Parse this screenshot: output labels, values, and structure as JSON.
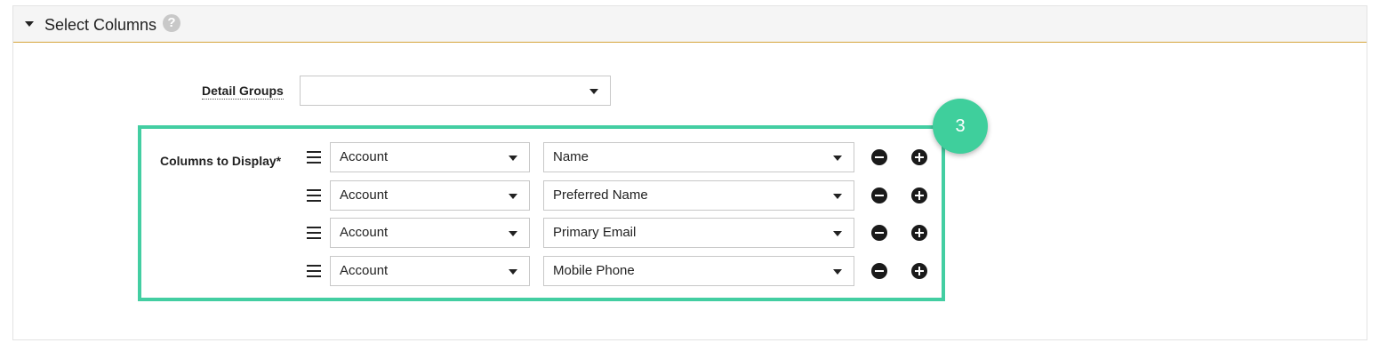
{
  "section": {
    "title": "Select Columns",
    "help_icon": "question-circle-icon"
  },
  "detail_groups": {
    "label": "Detail Groups",
    "value": ""
  },
  "columns": {
    "label": "Columns to Display*",
    "rows": [
      {
        "source": "Account",
        "field": "Name"
      },
      {
        "source": "Account",
        "field": "Preferred Name"
      },
      {
        "source": "Account",
        "field": "Primary Email"
      },
      {
        "source": "Account",
        "field": "Mobile Phone"
      }
    ]
  },
  "callout": {
    "number": "3",
    "color": "#43cea2"
  }
}
